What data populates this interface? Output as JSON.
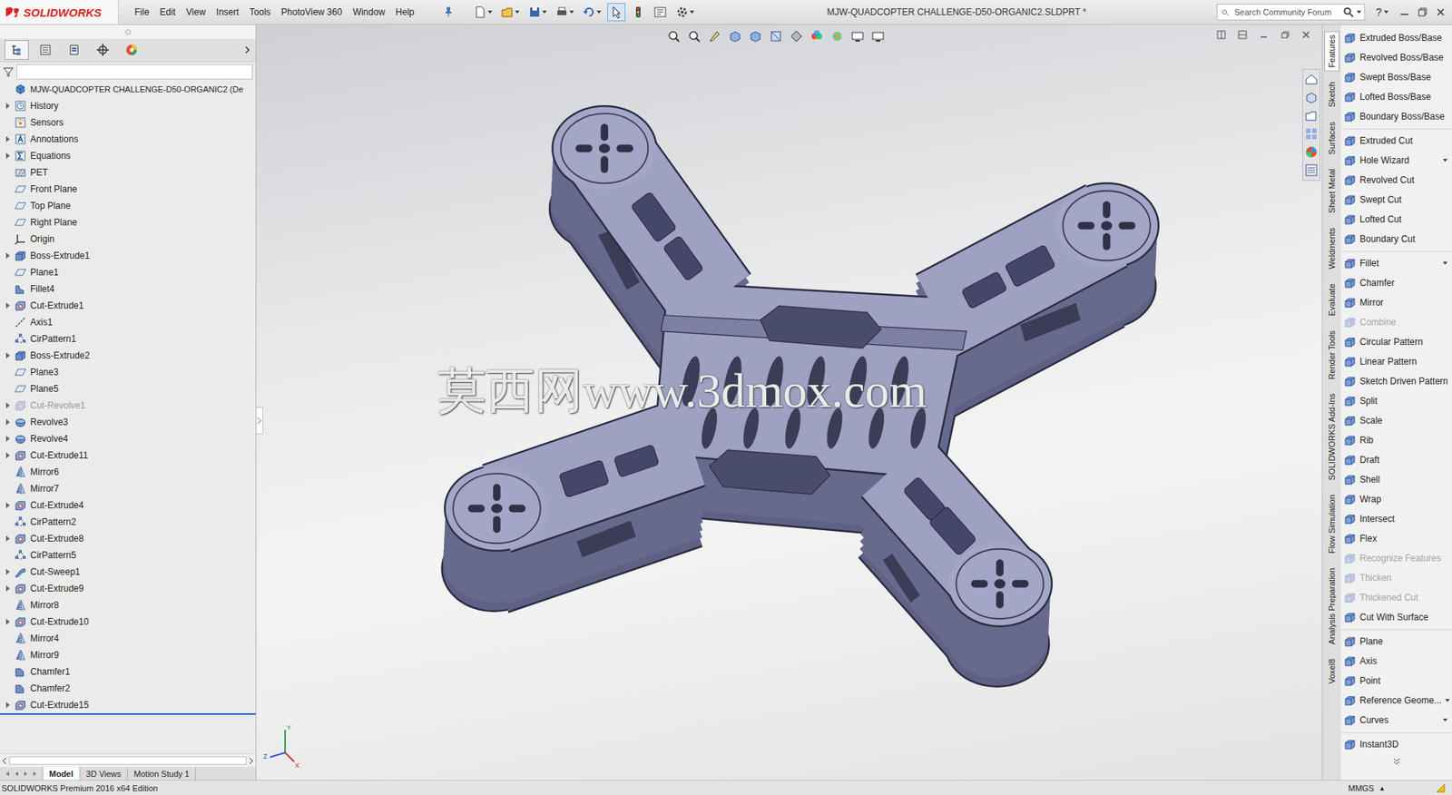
{
  "app": {
    "logo": "SOLIDWORKS",
    "title": "MJW-QUADCOPTER CHALLENGE-D50-ORGANIC2.SLDPRT *"
  },
  "menu": [
    "File",
    "Edit",
    "View",
    "Insert",
    "Tools",
    "PhotoView 360",
    "Window",
    "Help"
  ],
  "search": {
    "placeholder": "Search Community Forum"
  },
  "help": "?",
  "tree": {
    "root": {
      "label": "MJW-QUADCOPTER CHALLENGE-D50-ORGANIC2 (De",
      "kind": "part",
      "expandable": false,
      "disabled": false
    },
    "items": [
      {
        "label": "History",
        "kind": "history",
        "expandable": true,
        "disabled": false
      },
      {
        "label": "Sensors",
        "kind": "sensor",
        "expandable": false,
        "disabled": false
      },
      {
        "label": "Annotations",
        "kind": "annotation",
        "expandable": true,
        "disabled": false
      },
      {
        "label": "Equations",
        "kind": "equation",
        "expandable": true,
        "disabled": false
      },
      {
        "label": "PET",
        "kind": "material",
        "expandable": false,
        "disabled": false
      },
      {
        "label": "Front Plane",
        "kind": "plane",
        "expandable": false,
        "disabled": false
      },
      {
        "label": "Top Plane",
        "kind": "plane",
        "expandable": false,
        "disabled": false
      },
      {
        "label": "Right Plane",
        "kind": "plane",
        "expandable": false,
        "disabled": false
      },
      {
        "label": "Origin",
        "kind": "origin",
        "expandable": false,
        "disabled": false
      },
      {
        "label": "Boss-Extrude1",
        "kind": "boss",
        "expandable": true,
        "disabled": false
      },
      {
        "label": "Plane1",
        "kind": "plane",
        "expandable": false,
        "disabled": false
      },
      {
        "label": "Fillet4",
        "kind": "fillet",
        "expandable": false,
        "disabled": false
      },
      {
        "label": "Cut-Extrude1",
        "kind": "cut",
        "expandable": true,
        "disabled": false
      },
      {
        "label": "Axis1",
        "kind": "axis",
        "expandable": false,
        "disabled": false
      },
      {
        "label": "CirPattern1",
        "kind": "pattern",
        "expandable": false,
        "disabled": false
      },
      {
        "label": "Boss-Extrude2",
        "kind": "boss",
        "expandable": true,
        "disabled": false
      },
      {
        "label": "Plane3",
        "kind": "plane",
        "expandable": false,
        "disabled": false
      },
      {
        "label": "Plane5",
        "kind": "plane",
        "expandable": false,
        "disabled": false
      },
      {
        "label": "Cut-Revolve1",
        "kind": "cut",
        "expandable": true,
        "disabled": true
      },
      {
        "label": "Revolve3",
        "kind": "revolve",
        "expandable": true,
        "disabled": false
      },
      {
        "label": "Revolve4",
        "kind": "revolve",
        "expandable": true,
        "disabled": false
      },
      {
        "label": "Cut-Extrude11",
        "kind": "cut",
        "expandable": true,
        "disabled": false
      },
      {
        "label": "Mirror6",
        "kind": "mirror",
        "expandable": false,
        "disabled": false
      },
      {
        "label": "Mirror7",
        "kind": "mirror",
        "expandable": false,
        "disabled": false
      },
      {
        "label": "Cut-Extrude4",
        "kind": "cut",
        "expandable": true,
        "disabled": false
      },
      {
        "label": "CirPattern2",
        "kind": "pattern",
        "expandable": false,
        "disabled": false
      },
      {
        "label": "Cut-Extrude8",
        "kind": "cut",
        "expandable": true,
        "disabled": false
      },
      {
        "label": "CirPattern5",
        "kind": "pattern",
        "expandable": false,
        "disabled": false
      },
      {
        "label": "Cut-Sweep1",
        "kind": "sweep",
        "expandable": true,
        "disabled": false
      },
      {
        "label": "Cut-Extrude9",
        "kind": "cut",
        "expandable": true,
        "disabled": false
      },
      {
        "label": "Mirror8",
        "kind": "mirror",
        "expandable": false,
        "disabled": false
      },
      {
        "label": "Cut-Extrude10",
        "kind": "cut",
        "expandable": true,
        "disabled": false
      },
      {
        "label": "Mirror4",
        "kind": "mirror",
        "expandable": false,
        "disabled": false
      },
      {
        "label": "Mirror9",
        "kind": "mirror",
        "expandable": false,
        "disabled": false
      },
      {
        "label": "Chamfer1",
        "kind": "chamfer",
        "expandable": false,
        "disabled": false
      },
      {
        "label": "Chamfer2",
        "kind": "chamfer",
        "expandable": false,
        "disabled": false
      },
      {
        "label": "Cut-Extrude15",
        "kind": "cut",
        "expandable": true,
        "disabled": false
      }
    ]
  },
  "bottom_tabs": [
    {
      "label": "Model",
      "selected": true
    },
    {
      "label": "3D Views",
      "selected": false
    },
    {
      "label": "Motion Study 1",
      "selected": false
    }
  ],
  "watermark": "莫西网www.3dmox.com",
  "triad": [
    {
      "label": "Y",
      "color": "#2e9e4f"
    },
    {
      "label": "Z",
      "color": "#2f56c8"
    },
    {
      "label": "X",
      "color": "#c83232"
    }
  ],
  "command_tabs": [
    {
      "label": "Features",
      "selected": true
    },
    {
      "label": "Sketch",
      "selected": false
    },
    {
      "label": "Surfaces",
      "selected": false
    },
    {
      "label": "Sheet Metal",
      "selected": false
    },
    {
      "label": "Weldments",
      "selected": false
    },
    {
      "label": "Evaluate",
      "selected": false
    },
    {
      "label": "Render Tools",
      "selected": false
    },
    {
      "label": "SOLIDWORKS Add-Ins",
      "selected": false
    },
    {
      "label": "Flow Simulation",
      "selected": false
    },
    {
      "label": "Analysis Preparation",
      "selected": false
    },
    {
      "label": "Voxel8",
      "selected": false
    }
  ],
  "commands": [
    {
      "items": [
        {
          "label": "Extruded Boss/Base",
          "disabled": false,
          "dropdown": false
        },
        {
          "label": "Revolved Boss/Base",
          "disabled": false,
          "dropdown": false
        },
        {
          "label": "Swept Boss/Base",
          "disabled": false,
          "dropdown": false
        },
        {
          "label": "Lofted Boss/Base",
          "disabled": false,
          "dropdown": false
        },
        {
          "label": "Boundary Boss/Base",
          "disabled": false,
          "dropdown": false
        }
      ]
    },
    {
      "items": [
        {
          "label": "Extruded Cut",
          "disabled": false,
          "dropdown": false
        },
        {
          "label": "Hole Wizard",
          "disabled": false,
          "dropdown": true
        },
        {
          "label": "Revolved Cut",
          "disabled": false,
          "dropdown": false
        },
        {
          "label": "Swept Cut",
          "disabled": false,
          "dropdown": false
        },
        {
          "label": "Lofted Cut",
          "disabled": false,
          "dropdown": false
        },
        {
          "label": "Boundary Cut",
          "disabled": false,
          "dropdown": false
        }
      ]
    },
    {
      "items": [
        {
          "label": "Fillet",
          "disabled": false,
          "dropdown": true
        },
        {
          "label": "Chamfer",
          "disabled": false,
          "dropdown": false
        },
        {
          "label": "Mirror",
          "disabled": false,
          "dropdown": false
        },
        {
          "label": "Combine",
          "disabled": true,
          "dropdown": false
        },
        {
          "label": "Circular Pattern",
          "disabled": false,
          "dropdown": false
        },
        {
          "label": "Linear Pattern",
          "disabled": false,
          "dropdown": false
        },
        {
          "label": "Sketch Driven Pattern",
          "disabled": false,
          "dropdown": false
        },
        {
          "label": "Split",
          "disabled": false,
          "dropdown": false
        },
        {
          "label": "Scale",
          "disabled": false,
          "dropdown": false
        },
        {
          "label": "Rib",
          "disabled": false,
          "dropdown": false
        },
        {
          "label": "Draft",
          "disabled": false,
          "dropdown": false
        },
        {
          "label": "Shell",
          "disabled": false,
          "dropdown": false
        },
        {
          "label": "Wrap",
          "disabled": false,
          "dropdown": false
        },
        {
          "label": "Intersect",
          "disabled": false,
          "dropdown": false
        },
        {
          "label": "Flex",
          "disabled": false,
          "dropdown": false
        },
        {
          "label": "Recognize Features",
          "disabled": true,
          "dropdown": false
        },
        {
          "label": "Thicken",
          "disabled": true,
          "dropdown": false
        },
        {
          "label": "Thickened Cut",
          "disabled": true,
          "dropdown": false
        },
        {
          "label": "Cut With Surface",
          "disabled": false,
          "dropdown": false
        }
      ]
    },
    {
      "items": [
        {
          "label": "Plane",
          "disabled": false,
          "dropdown": false
        },
        {
          "label": "Axis",
          "disabled": false,
          "dropdown": false
        },
        {
          "label": "Point",
          "disabled": false,
          "dropdown": false
        },
        {
          "label": "Reference Geome...",
          "disabled": false,
          "dropdown": true
        },
        {
          "label": "Curves",
          "disabled": false,
          "dropdown": true
        }
      ]
    },
    {
      "items": [
        {
          "label": "Instant3D",
          "disabled": false,
          "dropdown": false
        }
      ]
    }
  ],
  "status": {
    "text": "SOLIDWORKS Premium 2016 x64 Edition",
    "units": "MMGS",
    "units_arrow": "▴"
  }
}
